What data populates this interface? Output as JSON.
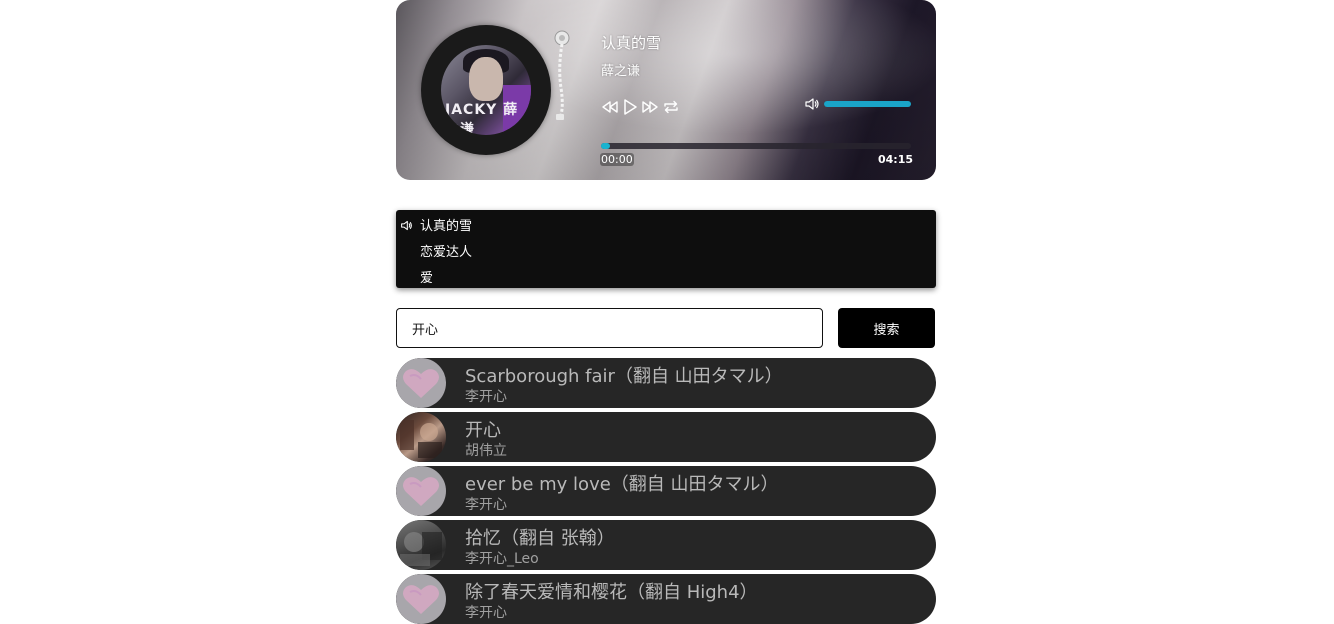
{
  "player": {
    "song_title": "认真的雪",
    "artist": "薛之谦",
    "album_cover_text": "JACKY 薛之谦",
    "current_time": "00:00",
    "total_time": "04:15",
    "progress": 0.03,
    "volume": 1.0,
    "accent_color": "#19b3cf"
  },
  "playlist": {
    "items": [
      {
        "label": "认真的雪",
        "playing": true
      },
      {
        "label": "恋爱达人",
        "playing": false
      },
      {
        "label": "爱",
        "playing": false
      }
    ]
  },
  "search": {
    "value": "开心",
    "button_label": "搜索"
  },
  "results": [
    {
      "title": "Scarborough fair（翻自 山田タマル）",
      "artist": "李开心",
      "thumb": "heart"
    },
    {
      "title": "开心",
      "artist": "胡伟立",
      "thumb": "photo"
    },
    {
      "title": "ever be my love（翻自 山田タマル）",
      "artist": "李开心",
      "thumb": "heart"
    },
    {
      "title": "拾忆（翻自 张翰）",
      "artist": "李开心_Leo",
      "thumb": "photo"
    },
    {
      "title": "除了春天爱情和樱花（翻自 High4）",
      "artist": "李开心",
      "thumb": "heart"
    }
  ]
}
